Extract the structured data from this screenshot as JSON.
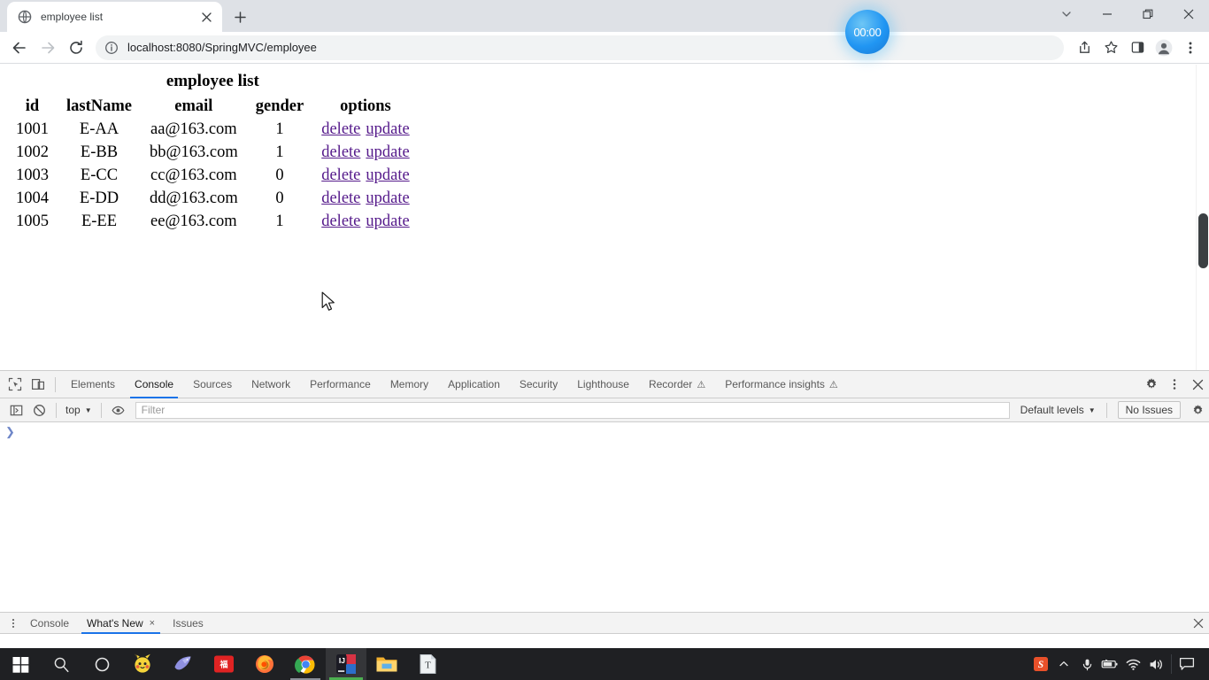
{
  "browser": {
    "tab": {
      "title": "employee list",
      "favicon": "globe-icon",
      "close_label": "×"
    },
    "newtab_label": "+",
    "window_controls": {
      "tablist_label": "∨",
      "minimize_label": "—",
      "maximize_label": "❐",
      "close_label": "×"
    },
    "toolbar": {
      "back_label": "←",
      "forward_label": "→",
      "reload_label": "⟳",
      "info_label": "ⓘ",
      "url": "localhost:8080/SpringMVC/employee",
      "share_label": "share-icon",
      "bookmark_label": "☆",
      "sidepanel_label": "sidepanel-icon",
      "profile_label": "profile-icon",
      "menu_label": "⋮"
    }
  },
  "overlay": {
    "timer": "00:00"
  },
  "page": {
    "caption": "employee list",
    "columns": [
      "id",
      "lastName",
      "email",
      "gender",
      "options"
    ],
    "rows": [
      {
        "id": "1001",
        "lastName": "E-AA",
        "email": "aa@163.com",
        "gender": "1",
        "delete": "delete",
        "update": "update"
      },
      {
        "id": "1002",
        "lastName": "E-BB",
        "email": "bb@163.com",
        "gender": "1",
        "delete": "delete",
        "update": "update"
      },
      {
        "id": "1003",
        "lastName": "E-CC",
        "email": "cc@163.com",
        "gender": "0",
        "delete": "delete",
        "update": "update"
      },
      {
        "id": "1004",
        "lastName": "E-DD",
        "email": "dd@163.com",
        "gender": "0",
        "delete": "delete",
        "update": "update"
      },
      {
        "id": "1005",
        "lastName": "E-EE",
        "email": "ee@163.com",
        "gender": "1",
        "delete": "delete",
        "update": "update"
      }
    ]
  },
  "devtools": {
    "inspect_label": "inspect-element-icon",
    "device_label": "device-toolbar-icon",
    "tabs": [
      {
        "label": "Elements",
        "active": false,
        "warn": false
      },
      {
        "label": "Console",
        "active": true,
        "warn": false
      },
      {
        "label": "Sources",
        "active": false,
        "warn": false
      },
      {
        "label": "Network",
        "active": false,
        "warn": false
      },
      {
        "label": "Performance",
        "active": false,
        "warn": false
      },
      {
        "label": "Memory",
        "active": false,
        "warn": false
      },
      {
        "label": "Application",
        "active": false,
        "warn": false
      },
      {
        "label": "Security",
        "active": false,
        "warn": false
      },
      {
        "label": "Lighthouse",
        "active": false,
        "warn": false
      },
      {
        "label": "Recorder",
        "active": false,
        "warn": true
      },
      {
        "label": "Performance insights",
        "active": false,
        "warn": true
      }
    ],
    "warn_glyph": "⚠",
    "settings_label": "⚙",
    "more_label": "⋮",
    "close_label": "×",
    "console_toolbar": {
      "sidebar_label": "console-sidebar-icon",
      "clear_label": "⊘",
      "context": "top",
      "caret": "▼",
      "eye_label": "live-expression-icon",
      "filter_placeholder": "Filter",
      "filter_value": "",
      "levels": "Default levels",
      "issues": "No Issues",
      "settings_label": "⚙"
    },
    "prompt": "❯"
  },
  "drawer": {
    "menu_label": "⋮",
    "tabs": [
      {
        "label": "Console",
        "active": false,
        "closable": false
      },
      {
        "label": "What's New",
        "active": true,
        "closable": true
      },
      {
        "label": "Issues",
        "active": false,
        "closable": false
      }
    ],
    "close_glyph": "×",
    "panel_close_label": "×"
  },
  "taskbar": {
    "items": [
      {
        "name": "start-button",
        "icon": "windows-logo"
      },
      {
        "name": "search-button",
        "icon": "magnifier"
      },
      {
        "name": "cortana-button",
        "icon": "circle"
      },
      {
        "name": "taskbar-app-pikachu",
        "icon": "pikachu"
      },
      {
        "name": "taskbar-app-dolphin",
        "icon": "dolphin"
      },
      {
        "name": "taskbar-app-red",
        "icon": "red-square-cn"
      },
      {
        "name": "taskbar-app-firefox",
        "icon": "firefox"
      },
      {
        "name": "taskbar-app-chrome",
        "icon": "chrome"
      },
      {
        "name": "taskbar-app-intellij",
        "icon": "intellij-idea"
      },
      {
        "name": "taskbar-app-explorer",
        "icon": "file-explorer"
      },
      {
        "name": "taskbar-app-typora",
        "icon": "typora"
      }
    ],
    "tray": [
      {
        "name": "tray-sogou-input",
        "icon": "sogou-s"
      },
      {
        "name": "tray-overflow-chevron",
        "icon": "chevron-up"
      },
      {
        "name": "tray-microphone",
        "icon": "microphone"
      },
      {
        "name": "tray-battery",
        "icon": "battery"
      },
      {
        "name": "tray-network",
        "icon": "wifi"
      },
      {
        "name": "tray-volume",
        "icon": "speaker"
      },
      {
        "name": "tray-notifications",
        "icon": "speech-bubble"
      }
    ]
  }
}
